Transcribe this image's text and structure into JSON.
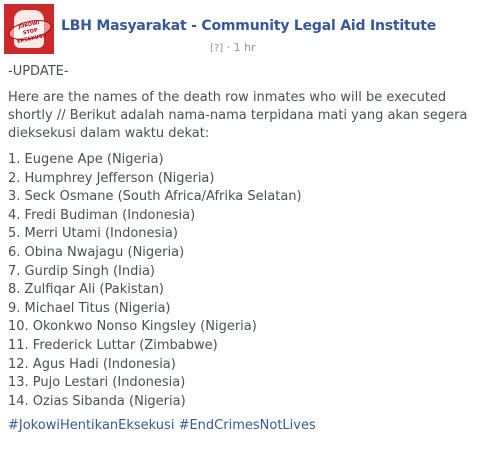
{
  "page": {
    "name": "LBH Masyarakat - Community Legal Aid Institute",
    "privacy_icon": "[?]",
    "timestamp": "1 hr"
  },
  "avatar": {
    "stamp_line1": "JOKOWI",
    "stamp_line2": "STOP",
    "stamp_line3": "EKSEKUSI!"
  },
  "post": {
    "update_label": "-UPDATE-",
    "intro": "Here are the names of the death row inmates who will be executed shortly // Berikut adalah nama-nama terpidana mati yang akan segera dieksekusi dalam waktu dekat:",
    "inmates": [
      "1. Eugene Ape (Nigeria)",
      "2. Humphrey Jefferson (Nigeria)",
      "3. Seck Osmane (South Africa/Afrika Selatan)",
      "4. Fredi Budiman (Indonesia)",
      "5. Merri Utami (Indonesia)",
      "6. Obina Nwajagu (Nigeria)",
      "7. Gurdip Singh (India)",
      "8. Zulfiqar Ali (Pakistan)",
      "9. Michael Titus (Nigeria)",
      "10. Okonkwo Nonso Kingsley (Nigeria)",
      "11. Frederick Luttar (Zimbabwe)",
      "12. Agus Hadi (Indonesia)",
      "13. Pujo Lestari (Indonesia)",
      "14. Ozias Sibanda (Nigeria)"
    ],
    "hashtags": [
      "#JokowiHentikanEksekusi",
      "#EndCrimesNotLives"
    ]
  },
  "colors": {
    "link": "#365899",
    "body_text": "#4b4f56",
    "meta_text": "#90949c",
    "avatar_red": "#cc2a2a"
  }
}
